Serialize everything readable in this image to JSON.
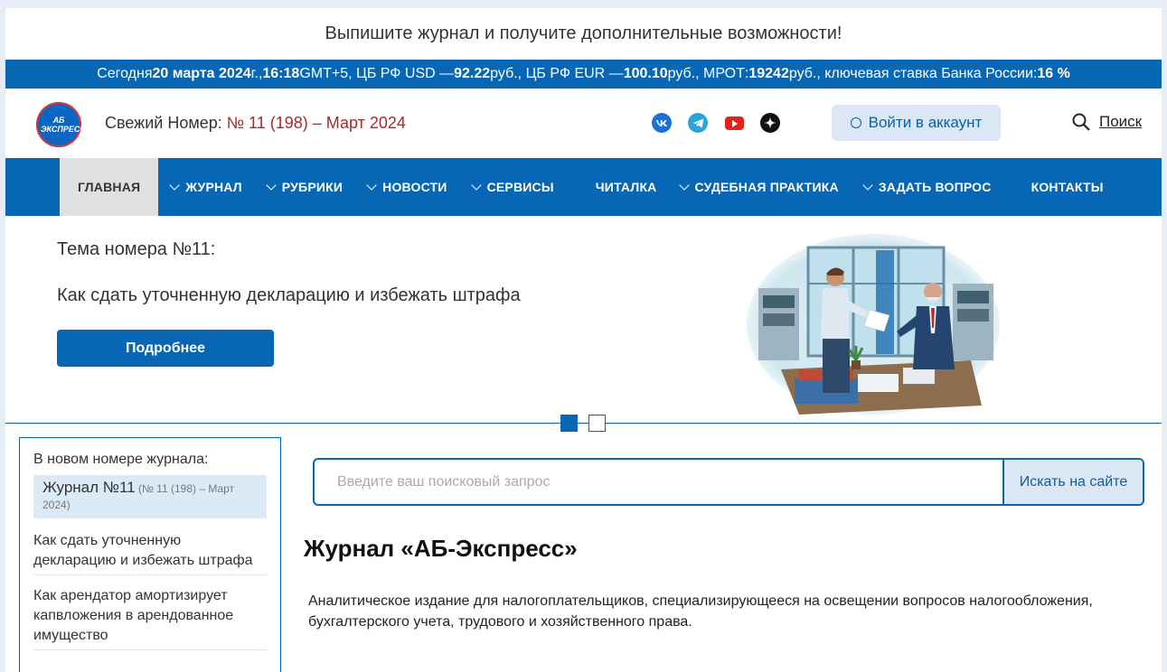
{
  "promo": {
    "text": "Выпишите журнал и получите дополнительные возможности!"
  },
  "rates": {
    "p1": "Сегодня ",
    "date": "20 марта 2024",
    "p2": " г., ",
    "time": "16:18",
    "p3": " GMT+5, ЦБ РФ USD — ",
    "usd": "92.22",
    "p4": " руб., ЦБ РФ EUR — ",
    "eur": "100.10",
    "p5": " руб., МРОТ: ",
    "mrot": "19242",
    "p6": " руб., ключевая ставка Банка России: ",
    "key_rate": "16 %"
  },
  "header": {
    "logo_text": "АБ ЭКСПРЕСС",
    "issue_label": "Свежий Номер: ",
    "issue_link": "№ 11 (198) – Март 2024",
    "social": [
      "vk-icon",
      "telegram-icon",
      "youtube-icon",
      "dzen-icon"
    ],
    "login_label": "Войти в аккаунт",
    "search_label": "Поиск"
  },
  "nav": {
    "items": [
      "ГЛАВНАЯ",
      "ЖУРНАЛ",
      "РУБРИКИ",
      "НОВОСТИ",
      "СЕРВИСЫ",
      "ЧИТАЛКА",
      "СУДЕБНАЯ ПРАКТИКА",
      "ЗАДАТЬ ВОПРОС",
      "КОНТАКТЫ"
    ]
  },
  "hero": {
    "topic_label": "Тема номера №11:",
    "topic_title": "Как сдать уточненную декларацию и избежать штрафа",
    "button": "Подробнее",
    "slides_total": 2,
    "slide_active": 1
  },
  "sidebar": {
    "heading": "В новом номере журнала:",
    "current_big": "Журнал №11",
    "current_small": " (№ 11 (198) – Март 2024)",
    "articles": [
      "Как сдать уточненную декларацию и избежать штрафа",
      "Как арендатор амортизирует капвложения в арендованное имущество"
    ]
  },
  "search": {
    "placeholder": "Введите ваш поисковый запрос",
    "button": "Искать на сайте"
  },
  "main": {
    "title": "Журнал «АБ-Экспресс»",
    "description": "Аналитическое издание для налогоплательщиков, специализирующееся на освещении вопросов налогообложения, бухгалтерского учета, трудового и хозяйственного права."
  },
  "colors": {
    "brand": "#0767b5",
    "active_nav": "#e0e0e0",
    "issue_link": "#a52a2a"
  }
}
